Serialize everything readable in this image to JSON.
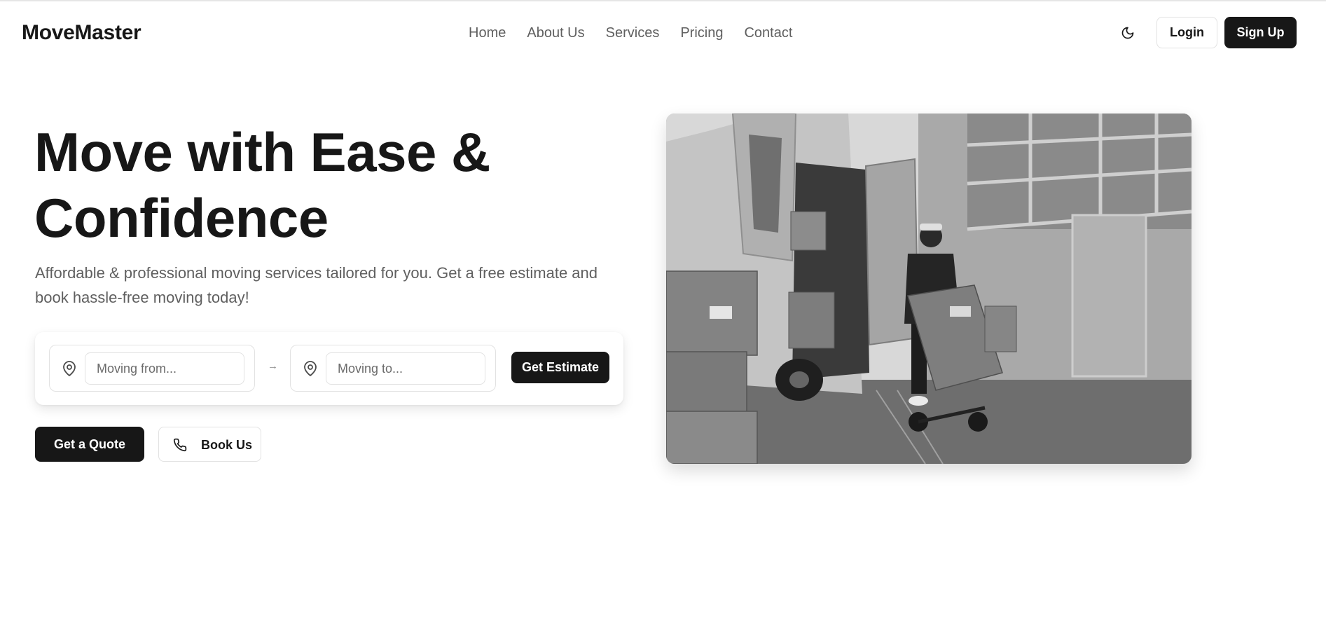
{
  "brand": {
    "name": "MoveMaster"
  },
  "nav": {
    "items": [
      {
        "label": "Home"
      },
      {
        "label": "About Us"
      },
      {
        "label": "Services"
      },
      {
        "label": "Pricing"
      },
      {
        "label": "Contact"
      }
    ]
  },
  "header": {
    "theme_toggle_icon": "moon-icon",
    "login_label": "Login",
    "signup_label": "Sign Up"
  },
  "hero": {
    "headline_line1": "Move with Ease &",
    "headline_line2": "Confidence",
    "subtext": "Affordable & professional moving services tailored for you. Get a free estimate and book hassle-free moving today!",
    "image_icon": "moving-van-photo"
  },
  "estimate_form": {
    "from_placeholder": "Moving from...",
    "from_value": "",
    "to_placeholder": "Moving to...",
    "to_value": "",
    "pin_icon": "map-pin-icon",
    "arrow": "→",
    "button_label": "Get Estimate"
  },
  "cta": {
    "quote_label": "Get a Quote",
    "book_label": "Book Us",
    "book_icon": "phone-icon"
  },
  "colors": {
    "primary": "#171717",
    "text_muted": "#5f5f5f",
    "border": "#e2e2e2",
    "background": "#ffffff"
  }
}
